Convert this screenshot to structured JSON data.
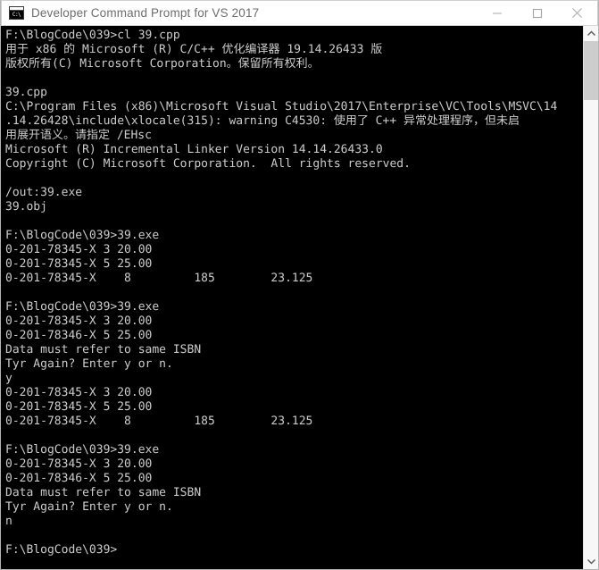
{
  "window": {
    "title": "Developer Command Prompt for VS 2017",
    "icon_name": "console-app-icon",
    "icon_text": "C:\\",
    "background_color": "#000000",
    "text_color": "#cccccc",
    "titlebar_color": "#ffffff",
    "titlebar_text_color": "#6d6d6d"
  },
  "controls": {
    "minimize_label": "Minimize",
    "maximize_label": "Maximize",
    "close_label": "Close"
  },
  "scrollbar": {
    "up_arrow_label": "Scroll up",
    "down_arrow_label": "Scroll down",
    "thumb_label": "Scrollbar thumb"
  },
  "console": {
    "prompt": "F:\\BlogCode\\039>",
    "lines": [
      "F:\\BlogCode\\039>cl 39.cpp",
      "用于 x86 的 Microsoft (R) C/C++ 优化编译器 19.14.26433 版",
      "版权所有(C) Microsoft Corporation。保留所有权利。",
      "",
      "39.cpp",
      "C:\\Program Files (x86)\\Microsoft Visual Studio\\2017\\Enterprise\\VC\\Tools\\MSVC\\14",
      ".14.26428\\include\\xlocale(315): warning C4530: 使用了 C++ 异常处理程序，但未启",
      "用展开语义。请指定 /EHsc",
      "Microsoft (R) Incremental Linker Version 14.14.26433.0",
      "Copyright (C) Microsoft Corporation.  All rights reserved.",
      "",
      "/out:39.exe",
      "39.obj",
      "",
      "F:\\BlogCode\\039>39.exe",
      "0-201-78345-X 3 20.00",
      "0-201-78345-X 5 25.00",
      "0-201-78345-X    8         185        23.125",
      "",
      "F:\\BlogCode\\039>39.exe",
      "0-201-78345-X 3 20.00",
      "0-201-78346-X 5 25.00",
      "Data must refer to same ISBN",
      "Tyr Again? Enter y or n.",
      "y",
      "0-201-78345-X 3 20.00",
      "0-201-78345-X 5 25.00",
      "0-201-78345-X    8         185        23.125",
      "",
      "F:\\BlogCode\\039>39.exe",
      "0-201-78345-X 3 20.00",
      "0-201-78346-X 5 25.00",
      "Data must refer to same ISBN",
      "Tyr Again? Enter y or n.",
      "n",
      "",
      "F:\\BlogCode\\039>"
    ]
  }
}
